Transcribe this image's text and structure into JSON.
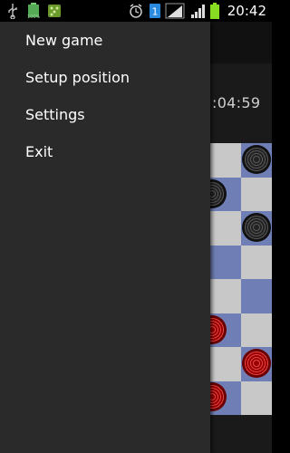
{
  "status_bar": {
    "time": "20:42",
    "battery_percent_label": "100%",
    "icons": [
      "usb-icon",
      "battery-full-icon",
      "game-notification-icon",
      "alarm-icon",
      "sim1-icon",
      "signal-icon",
      "signal-icon-2",
      "battery-icon"
    ]
  },
  "game": {
    "timer": ":04:59"
  },
  "drawer": {
    "items": [
      {
        "label": "New game"
      },
      {
        "label": "Setup position"
      },
      {
        "label": "Settings"
      },
      {
        "label": "Exit"
      }
    ]
  },
  "colors": {
    "drawer_bg": "#2a2a2a",
    "board_light": "#c8c8c8",
    "board_dark": "#6f7fb5",
    "piece_black": "#222222",
    "piece_red": "#9a0000"
  }
}
